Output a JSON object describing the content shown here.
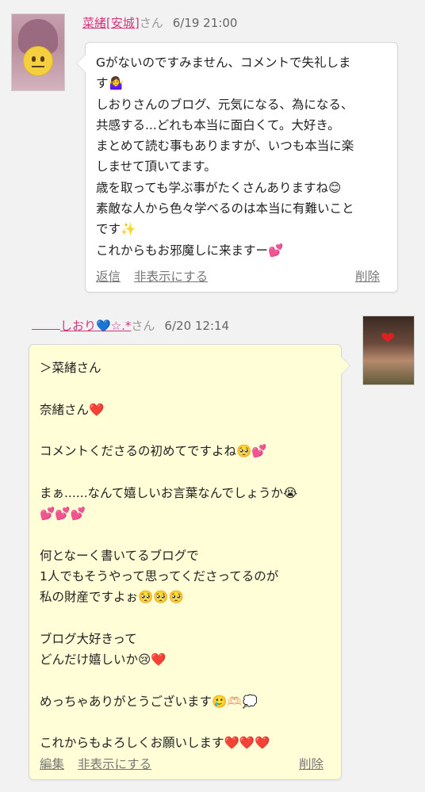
{
  "comments": [
    {
      "author": "菜緒[安城]",
      "honorific": "さん",
      "date": "6/19 21:00",
      "lines": [
        "Gがないのですみません、コメントで失礼しま",
        "す🤷‍♀️",
        "しおりさんのブログ、元気になる、為になる、",
        "共感する...どれも本当に面白くて。大好き。",
        "まとめて読む事もありますが、いつも本当に楽",
        "しませて頂いてます。",
        "歳を取っても学ぶ事がたくさんありますね😊",
        "素敵な人から色々学べるのは本当に有難いこと",
        "です✨",
        "これからもお邪魔しに来ますー💕"
      ],
      "actions": {
        "reply": "返信",
        "hide": "非表示にする",
        "delete": "削除"
      }
    },
    {
      "author": "しおり💙☆.*",
      "honorific": "さん",
      "date": "6/20 12:14",
      "lines": [
        "＞菜緒さん",
        "",
        "奈緒さん❤️",
        "",
        "コメントくださるの初めてですよね🥺💕",
        "",
        "まぁ......なんて嬉しいお言葉なんでしょうか😭",
        "💕💕💕",
        "",
        "何となーく書いてるブログで",
        "1人でもそうやって思ってくださってるのが",
        "私の財産ですよぉ🥺🥺🥺",
        "",
        "ブログ大好きって",
        "どんだけ嬉しいか😢❤️",
        "",
        "めっちゃありがとうございます🥲🫶🏻💭",
        "",
        "これからもよろしくお願いします❤️❤️❤️"
      ],
      "actions": {
        "edit": "編集",
        "hide": "非表示にする",
        "delete": "削除"
      }
    }
  ],
  "icons": {
    "left_avatar": "user-avatar-emoji",
    "right_avatar": "user-avatar-photo"
  }
}
